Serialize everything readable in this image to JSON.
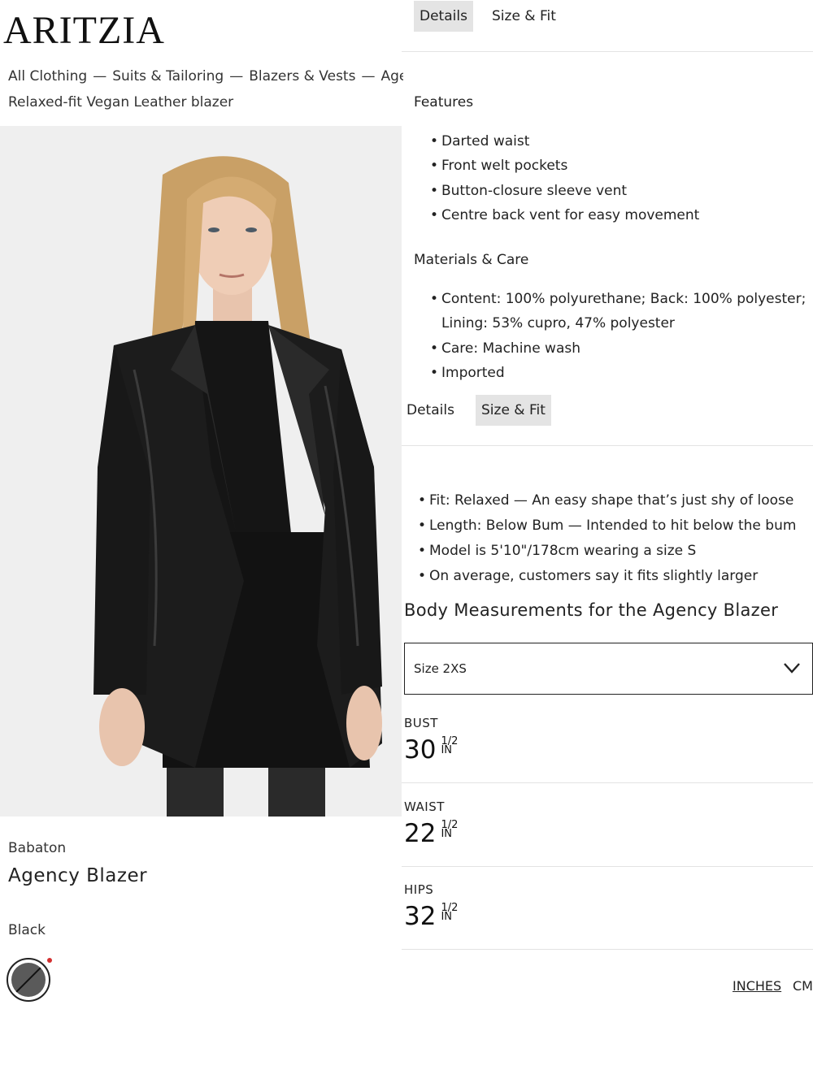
{
  "header": {
    "logo": "ARITZIA",
    "breadcrumb": [
      "All Clothing",
      "Suits & Tailoring",
      "Blazers & Vests",
      "Agency Blazer"
    ],
    "breadcrumb_sep": "—",
    "product_subtitle": "Relaxed-fit Vegan Leather blazer"
  },
  "product": {
    "brand": "Babaton",
    "name": "Agency Blazer",
    "color": "Black"
  },
  "details_panel": {
    "tabs": [
      {
        "label": "Details",
        "active": true
      },
      {
        "label": "Size & Fit",
        "active": false
      }
    ],
    "features_title": "Features",
    "features": [
      "Darted waist",
      "Front welt pockets",
      "Button-closure sleeve vent",
      "Centre back vent for easy movement"
    ],
    "materials_title": "Materials & Care",
    "materials": [
      "Content: 100% polyurethane; Back: 100% polyester; Lining: 53% cupro, 47% polyester",
      "Care: Machine wash",
      "Imported"
    ]
  },
  "size_panel": {
    "tabs": [
      {
        "label": "Details",
        "active": false
      },
      {
        "label": "Size & Fit",
        "active": true
      }
    ],
    "fit_notes": [
      "Fit: Relaxed — An easy shape that’s just shy of loose",
      "Length: Below Bum — Intended to hit below the bum",
      "Model is 5'10\"/178cm wearing a size S",
      "On average, customers say it fits slightly larger"
    ],
    "measurements_title": "Body Measurements for the Agency Blazer",
    "size_select": "Size 2XS",
    "measurements": [
      {
        "label": "BUST",
        "whole": "30",
        "frac": "1/2",
        "unit": "IN"
      },
      {
        "label": "WAIST",
        "whole": "22",
        "frac": "1/2",
        "unit": "IN"
      },
      {
        "label": "HIPS",
        "whole": "32",
        "frac": "1/2",
        "unit": "IN"
      }
    ],
    "units": [
      {
        "label": "INCHES",
        "active": true
      },
      {
        "label": "CM",
        "active": false
      }
    ]
  },
  "colors": {
    "tab_active_bg": "#e4e4e4",
    "swatch": "#5a5a5a",
    "swatch_dot": "#d32f2f"
  }
}
